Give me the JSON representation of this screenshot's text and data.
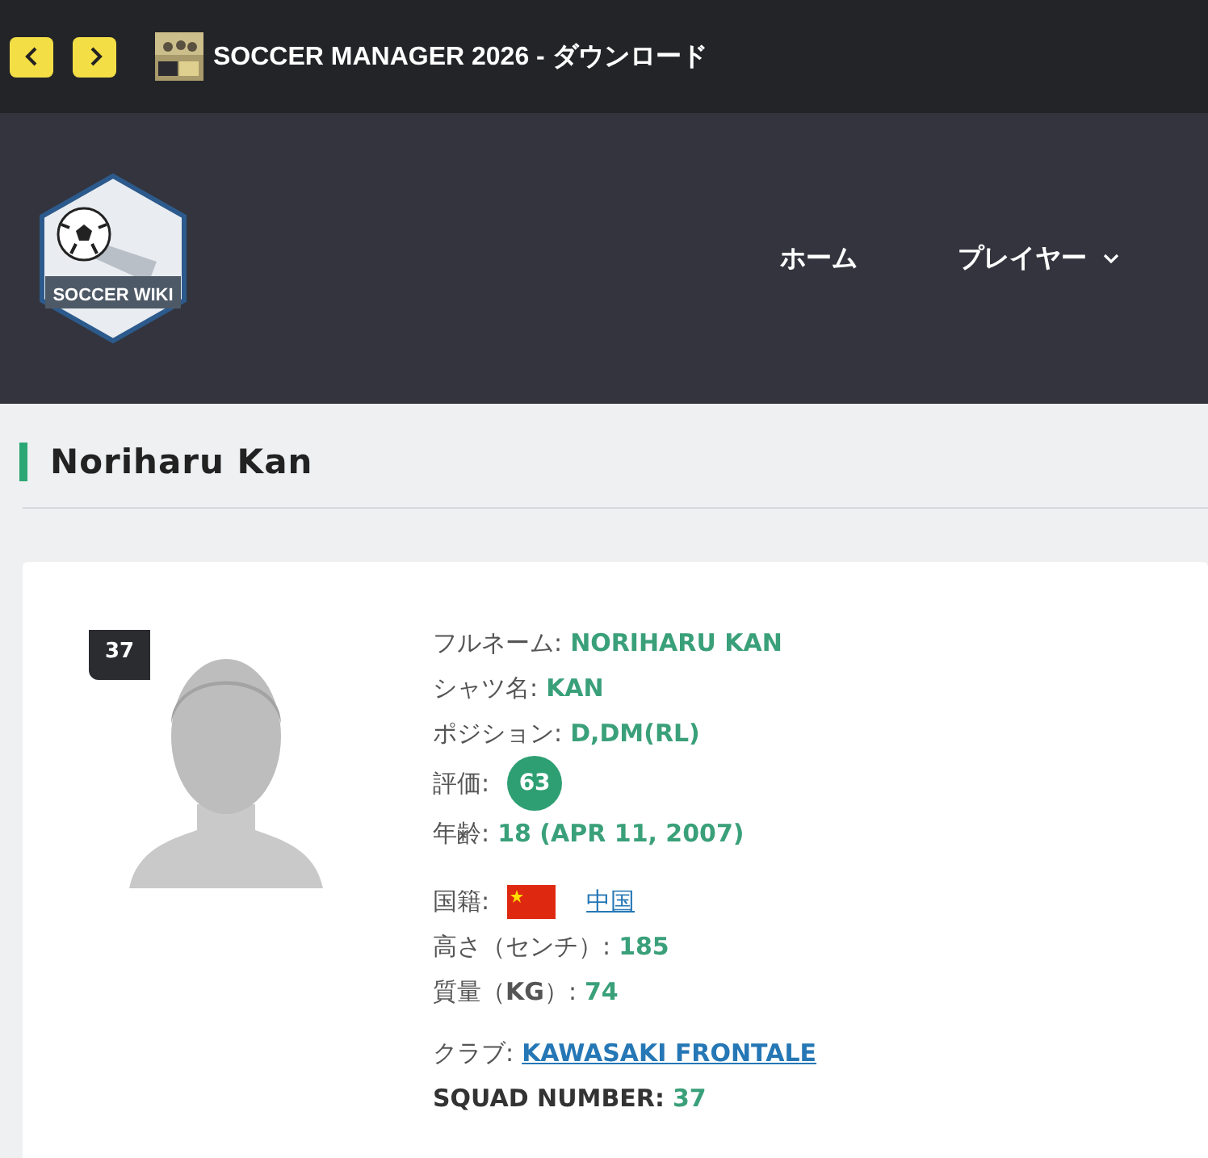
{
  "topbar": {
    "title": "SOCCER MANAGER 2026 - ダウンロード"
  },
  "logo": {
    "text": "SOCCER WIKI"
  },
  "nav": [
    {
      "label": "ホーム",
      "dropdown": false
    },
    {
      "label": "プレイヤー",
      "dropdown": true
    }
  ],
  "page_title": "Noriharu Kan",
  "player": {
    "number_badge": "37",
    "fields": [
      {
        "kind": "text",
        "label": "フルネーム:",
        "value": "NORIHARU KAN"
      },
      {
        "kind": "text",
        "label": "シャツ名:",
        "value": "KAN"
      },
      {
        "kind": "text",
        "label": "ポジション:",
        "value": "D,DM(RL)"
      },
      {
        "kind": "rating",
        "label": "評価:",
        "value": "63"
      },
      {
        "kind": "text",
        "label": "年齢:",
        "value": "18 (APR 11, 2007)"
      },
      {
        "kind": "flag",
        "label": "国籍:",
        "value": "中国"
      },
      {
        "kind": "text",
        "label": "高さ（センチ）:",
        "value": "185"
      },
      {
        "kind": "text",
        "label": "質量（**KG**）:",
        "value": "74"
      },
      {
        "kind": "link",
        "label": "クラブ:",
        "value": "KAWASAKI FRONTALE"
      },
      {
        "kind": "bold",
        "label": "SQUAD NUMBER:",
        "value": "37"
      }
    ]
  }
}
